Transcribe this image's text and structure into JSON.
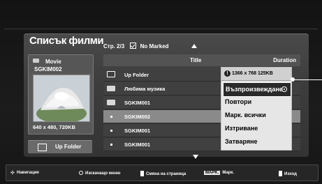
{
  "header": {
    "title": "Списък филми",
    "page_info": "Стр. 2/3",
    "marked_info": "No Marked"
  },
  "thumbnail": {
    "type_label": "Movie",
    "file_label": "SGKIM002",
    "size_label": "640 x 480, 720KB"
  },
  "sidebar": {
    "up_folder_label": "Up Folder"
  },
  "list": {
    "columns": {
      "title": "Title",
      "duration": "Duration"
    },
    "rows": [
      {
        "name": "Up Folder",
        "icon": "up-folder-icon"
      },
      {
        "name": "Любима музика",
        "icon": "folder-icon"
      },
      {
        "name": "SGKIM001",
        "icon": "folder-icon"
      },
      {
        "name": "SGKIM002",
        "icon": "movie-file-icon",
        "selected": true
      },
      {
        "name": "SGKIM001",
        "icon": "movie-file-icon"
      },
      {
        "name": "SGKIM001",
        "icon": "movie-file-icon"
      }
    ]
  },
  "popup": {
    "info": "1366 x 768 125KB",
    "options": [
      "Възпроизвеждане",
      "Повтори",
      "Марк. всички",
      "Изтриване",
      "Затваряне"
    ]
  },
  "footer": {
    "navigation": "Навигация",
    "popup_menu": "Изскачащо меню",
    "page_change": "Смяна на страница",
    "mark_key": "MAPK.",
    "mark": "Марк.",
    "exit": "Изход"
  }
}
